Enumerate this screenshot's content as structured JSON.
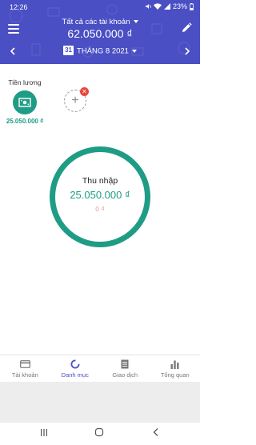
{
  "status_bar": {
    "time": "12:26",
    "battery": "23%"
  },
  "header": {
    "account_selector": "Tất cả các tài khoản",
    "total_balance": "62.050.000 ₫",
    "period": {
      "day_icon": "31",
      "label": "THÁNG 8 2021"
    },
    "prev_icon": "chevron-left-icon",
    "next_icon": "chevron-right-icon",
    "menu_icon": "hamburger-menu-icon",
    "edit_icon": "pencil-icon"
  },
  "categories": [
    {
      "label": "Tiền lương",
      "amount": "25.050.000 ₫",
      "icon": "cash-icon",
      "color": "#1f9c85"
    }
  ],
  "add_category": {
    "icon": "plus-icon",
    "badge_icon": "delete-icon"
  },
  "summary": {
    "title": "Thu nhập",
    "income": "25.050.000 ₫",
    "expense": "0 ₫",
    "ring_color": "#1f9c85"
  },
  "tabs": [
    {
      "label": "Tài khoản",
      "icon": "card-icon",
      "active": false
    },
    {
      "label": "Danh mục",
      "icon": "pie-icon",
      "active": true
    },
    {
      "label": "Giao dịch",
      "icon": "receipt-icon",
      "active": false
    },
    {
      "label": "Tổng quan",
      "icon": "bar-chart-icon",
      "active": false
    }
  ],
  "colors": {
    "primary": "#4a4fc4",
    "accent": "#1f9c85",
    "expense": "#e99a96"
  }
}
